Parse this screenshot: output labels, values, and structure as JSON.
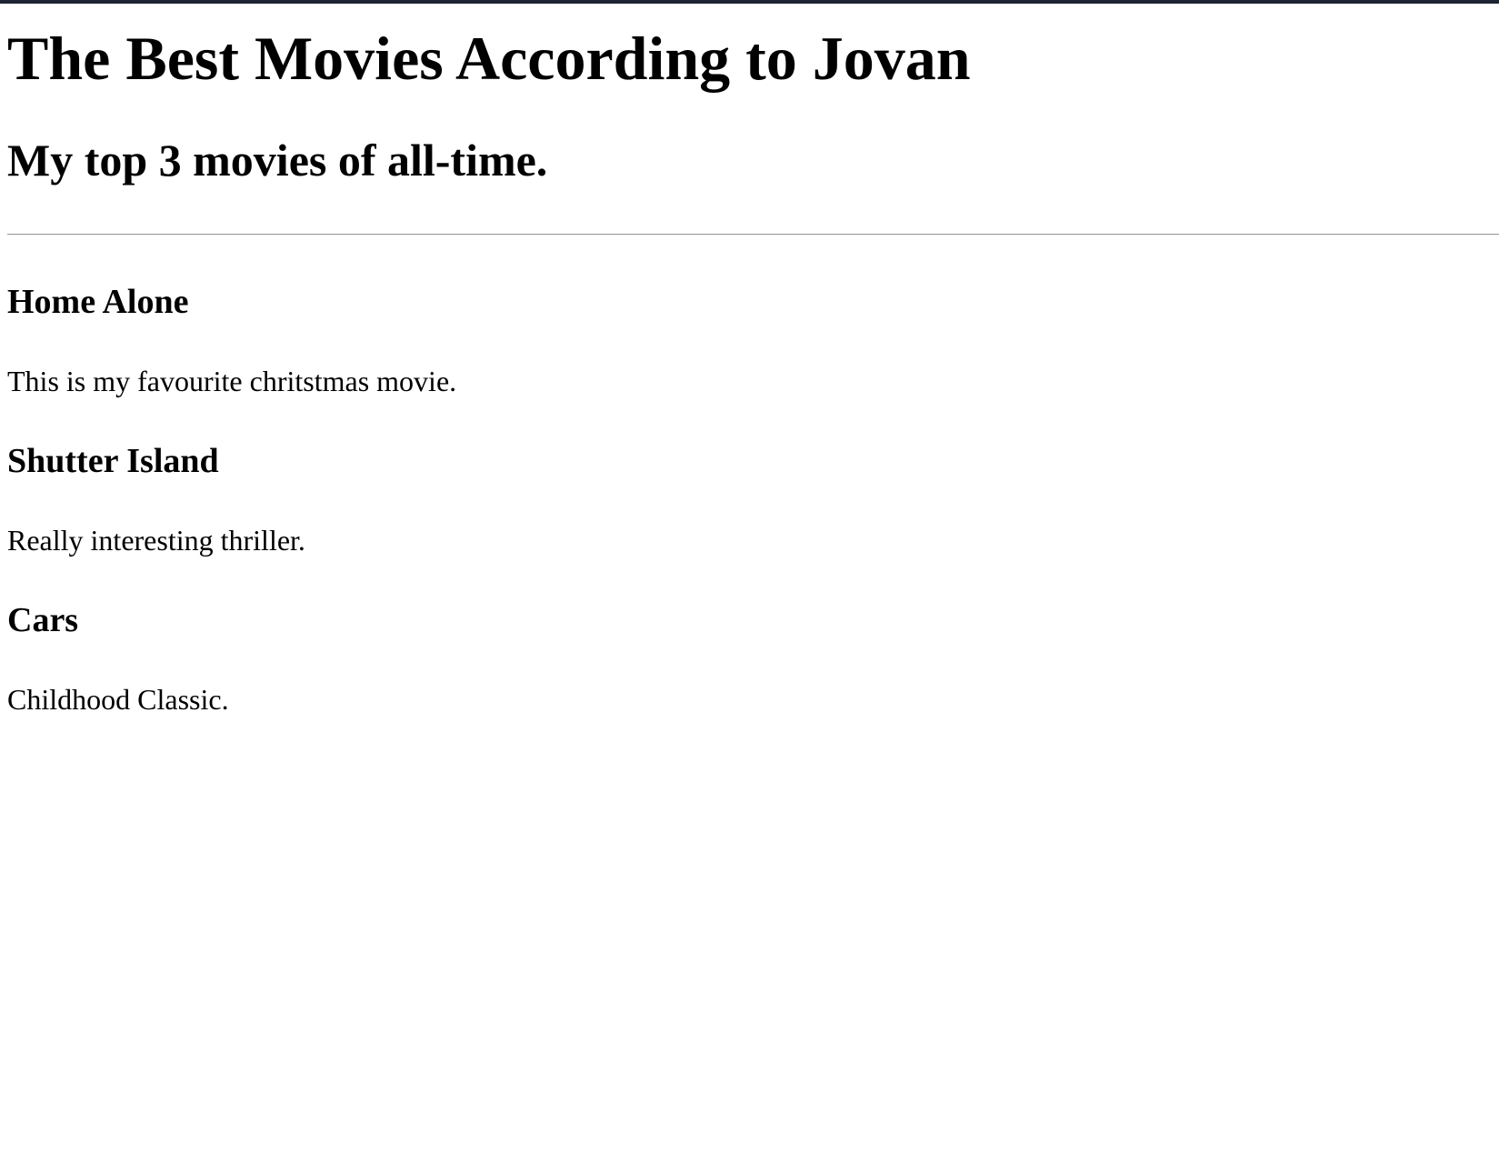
{
  "page": {
    "title": "The Best Movies According to Jovan",
    "subtitle": "My top 3 movies of all-time."
  },
  "movies": [
    {
      "title": "Home Alone",
      "description": "This is my favourite chritstmas movie."
    },
    {
      "title": "Shutter Island",
      "description": "Really interesting thriller."
    },
    {
      "title": "Cars",
      "description": "Childhood Classic."
    }
  ],
  "colors": {
    "top_bar": "#1f2433",
    "text": "#000000",
    "background": "#ffffff",
    "divider": "#9a9a9a"
  }
}
